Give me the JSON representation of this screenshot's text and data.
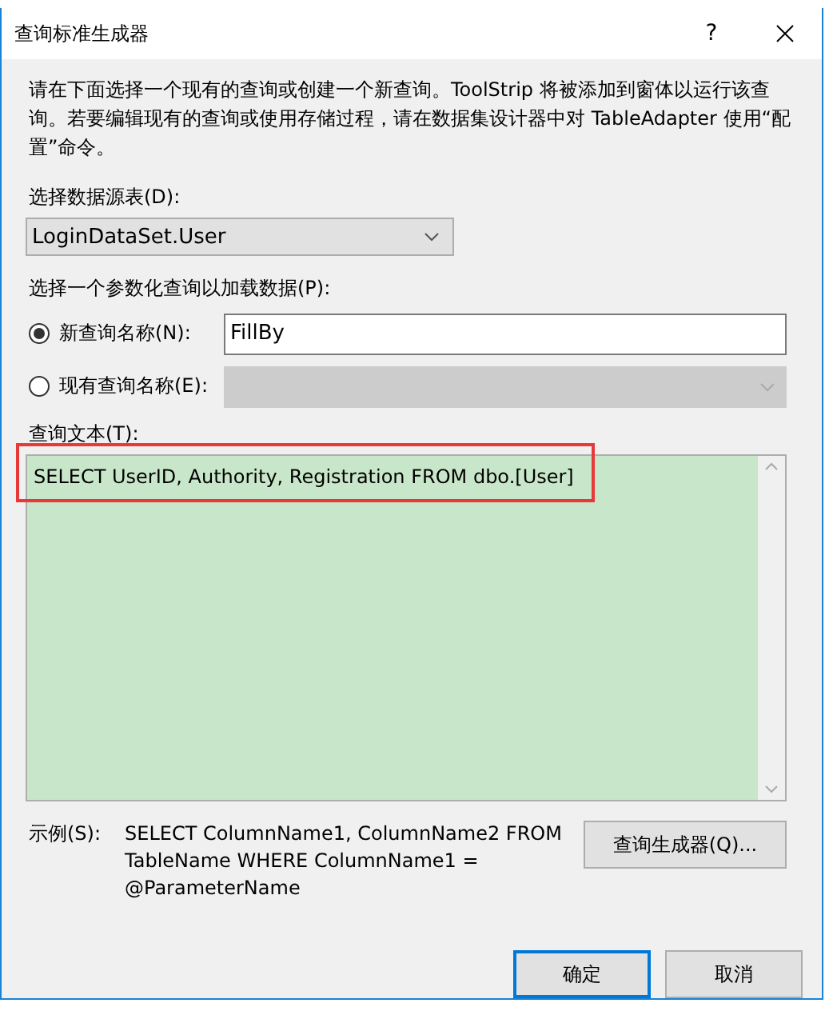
{
  "window": {
    "title": "查询标准生成器",
    "help": "?"
  },
  "intro": "请在下面选择一个现有的查询或创建一个新查询。ToolStrip 将被添加到窗体以运行该查询。若要编辑现有的查询或使用存储过程，请在数据集设计器中对 TableAdapter 使用“配置”命令。",
  "data_source": {
    "label": "选择数据源表(D):",
    "value": "LoginDataSet.User"
  },
  "query_choice": {
    "label": "选择一个参数化查询以加载数据(P):",
    "options": [
      {
        "label": "新查询名称(N):",
        "selected": true,
        "kind": "text",
        "value": "FillBy",
        "disabled": false
      },
      {
        "label": "现有查询名称(E):",
        "selected": false,
        "kind": "combo",
        "disabled": true
      }
    ]
  },
  "query_text": {
    "label": "查询文本(T):",
    "value": "SELECT UserID, Authority, Registration FROM dbo.[User]",
    "highlighted": true
  },
  "example": {
    "label": "示例(S):",
    "text": "SELECT ColumnName1, ColumnName2 FROM TableName WHERE ColumnName1 = @ParameterName"
  },
  "builder_button": "查询生成器(Q)...",
  "buttons": [
    {
      "label": "确定",
      "default": true
    },
    {
      "label": "取消",
      "default": false
    }
  ]
}
